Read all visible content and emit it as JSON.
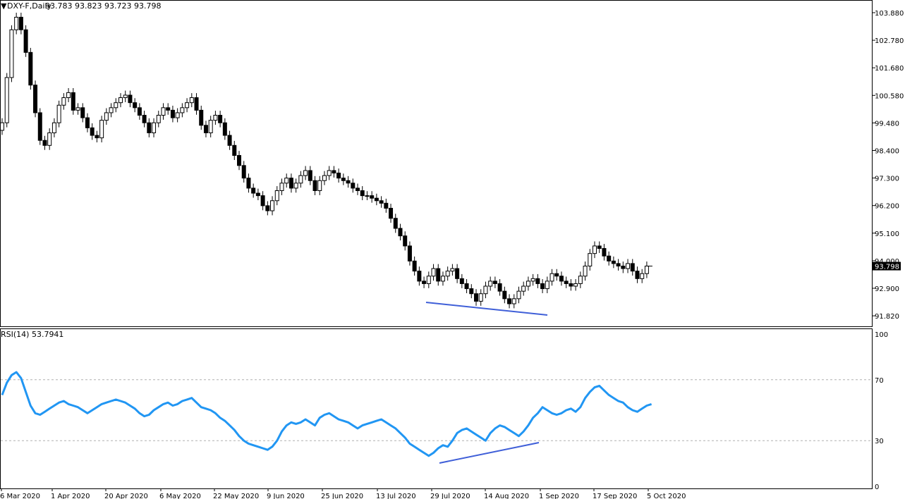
{
  "header": {
    "symbol_label": "DXY-F,Daily",
    "ohlc_label": "93.783 93.823 93.723 93.798"
  },
  "price_scale": {
    "ticks": [
      "103.880",
      "102.780",
      "101.680",
      "100.580",
      "99.480",
      "98.400",
      "97.300",
      "96.200",
      "95.100",
      "94.000",
      "92.900",
      "91.820"
    ],
    "current_price": "93.798"
  },
  "rsi_panel": {
    "label": "RSI(14) 53.7941",
    "ticks": [
      "100",
      "70",
      "30",
      "0"
    ],
    "levels": [
      70,
      30
    ]
  },
  "x_axis_labels": [
    "6 Mar 2020",
    "1 Apr 2020",
    "20 Apr 2020",
    "6 May 2020",
    "22 May 2020",
    "9 Jun 2020",
    "25 Jun 2020",
    "13 Jul 2020",
    "29 Jul 2020",
    "14 Aug 2020",
    "1 Sep 2020",
    "17 Sep 2020",
    "5 Oct 2020"
  ],
  "colors": {
    "rsi_line": "#2196f3",
    "divergence_line": "#3f5fd8",
    "candle": "#000000",
    "panel_border": "#000000"
  },
  "chart_data": [
    {
      "type": "candlestick",
      "title": "DXY-F,Daily",
      "y_range": [
        91.3,
        104.5
      ],
      "closes": [
        99.5,
        101.3,
        103.2,
        103.7,
        103.2,
        102.3,
        101.0,
        99.9,
        98.8,
        98.6,
        99.1,
        99.5,
        100.2,
        100.5,
        100.7,
        100.0,
        100.1,
        99.7,
        99.3,
        99.0,
        98.9,
        99.6,
        99.9,
        100.1,
        100.3,
        100.5,
        100.6,
        100.3,
        100.1,
        99.8,
        99.5,
        99.1,
        99.5,
        99.8,
        100.1,
        100.0,
        99.7,
        99.9,
        100.1,
        100.3,
        100.5,
        100.0,
        99.4,
        99.1,
        99.6,
        99.8,
        99.5,
        99.0,
        98.6,
        98.2,
        97.8,
        97.3,
        96.9,
        96.7,
        96.6,
        96.2,
        96.0,
        96.4,
        96.8,
        97.1,
        97.3,
        96.9,
        97.1,
        97.4,
        97.6,
        97.2,
        96.8,
        97.2,
        97.4,
        97.6,
        97.5,
        97.3,
        97.2,
        97.1,
        96.9,
        96.8,
        96.6,
        96.6,
        96.5,
        96.4,
        96.3,
        96.1,
        95.7,
        95.3,
        95.0,
        94.6,
        94.0,
        93.6,
        93.2,
        93.1,
        93.4,
        93.7,
        93.2,
        93.4,
        93.6,
        93.7,
        93.3,
        93.1,
        92.9,
        92.7,
        92.4,
        92.7,
        93.0,
        93.2,
        93.1,
        92.8,
        92.5,
        92.3,
        92.5,
        92.8,
        93.0,
        93.2,
        93.3,
        93.1,
        92.9,
        93.2,
        93.5,
        93.4,
        93.2,
        93.1,
        93.0,
        93.1,
        93.4,
        93.8,
        94.3,
        94.6,
        94.5,
        94.2,
        94.0,
        93.9,
        93.8,
        93.7,
        93.9,
        93.6,
        93.3,
        93.5,
        93.8
      ]
    },
    {
      "type": "line",
      "title": "RSI(14) 53.7941",
      "y_range": [
        0,
        100
      ],
      "series": [
        {
          "values": [
            60,
            68,
            73,
            75,
            71,
            62,
            53,
            48,
            47,
            49,
            51,
            53,
            55,
            56,
            54,
            53,
            52,
            50,
            48,
            50,
            52,
            54,
            55,
            56,
            57,
            56,
            55,
            53,
            51,
            48,
            46,
            47,
            50,
            52,
            54,
            55,
            53,
            54,
            56,
            57,
            58,
            55,
            52,
            51,
            50,
            48,
            45,
            43,
            40,
            37,
            33,
            30,
            28,
            27,
            26,
            25,
            24,
            26,
            30,
            36,
            40,
            42,
            41,
            42,
            44,
            42,
            40,
            45,
            47,
            48,
            46,
            44,
            43,
            42,
            40,
            38,
            40,
            41,
            42,
            43,
            44,
            42,
            40,
            38,
            35,
            32,
            28,
            26,
            24,
            22,
            20,
            22,
            25,
            27,
            26,
            30,
            35,
            37,
            38,
            36,
            34,
            32,
            30,
            35,
            38,
            40,
            39,
            37,
            35,
            33,
            36,
            40,
            45,
            48,
            52,
            50,
            48,
            47,
            48,
            50,
            51,
            49,
            52,
            58,
            62,
            65,
            66,
            63,
            60,
            58,
            56,
            55,
            52,
            50,
            49,
            51,
            53,
            54
          ]
        }
      ],
      "levels": [
        70,
        30
      ]
    }
  ]
}
